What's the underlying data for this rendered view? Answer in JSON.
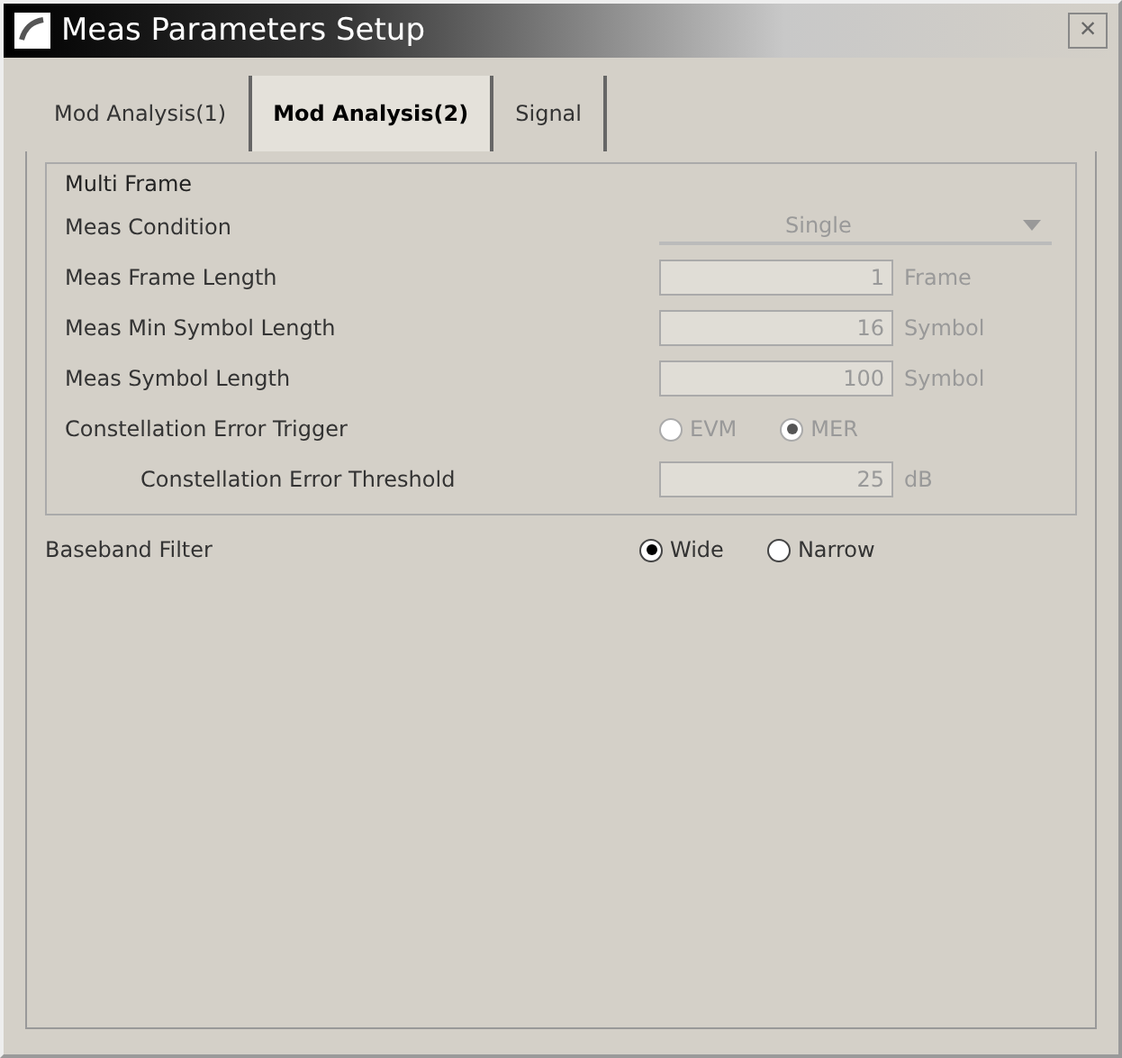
{
  "window": {
    "title": "Meas Parameters Setup",
    "close": "×"
  },
  "tabs": [
    {
      "label": "Mod Analysis(1)",
      "selected": false
    },
    {
      "label": "Mod Analysis(2)",
      "selected": true
    },
    {
      "label": "Signal",
      "selected": false
    }
  ],
  "group": {
    "title": "Multi Frame",
    "rows": [
      {
        "kind": "dropdown",
        "label": "Meas Condition",
        "value": "Single",
        "disabled": true,
        "indented": false
      },
      {
        "kind": "number",
        "label": "Meas Frame Length",
        "value": "1",
        "unit": "Frame",
        "disabled": true,
        "indented": false
      },
      {
        "kind": "number",
        "label": "Meas Min Symbol Length",
        "value": "16",
        "unit": "Symbol",
        "disabled": true,
        "indented": false
      },
      {
        "kind": "number",
        "label": "Meas Symbol Length",
        "value": "100",
        "unit": "Symbol",
        "disabled": true,
        "indented": false
      },
      {
        "kind": "radio",
        "label": "Constellation Error Trigger",
        "disabled": true,
        "indented": false,
        "options": [
          {
            "label": "EVM",
            "selected": false
          },
          {
            "label": "MER",
            "selected": true
          }
        ]
      },
      {
        "kind": "number",
        "label": "Constellation Error Threshold",
        "value": "25",
        "unit": "dB",
        "disabled": true,
        "indented": true
      }
    ]
  },
  "rows": [
    {
      "kind": "radio",
      "label": "Baseband Filter",
      "disabled": false,
      "indented": false,
      "options": [
        {
          "label": "Wide",
          "selected": true
        },
        {
          "label": "Narrow",
          "selected": false
        }
      ]
    }
  ]
}
